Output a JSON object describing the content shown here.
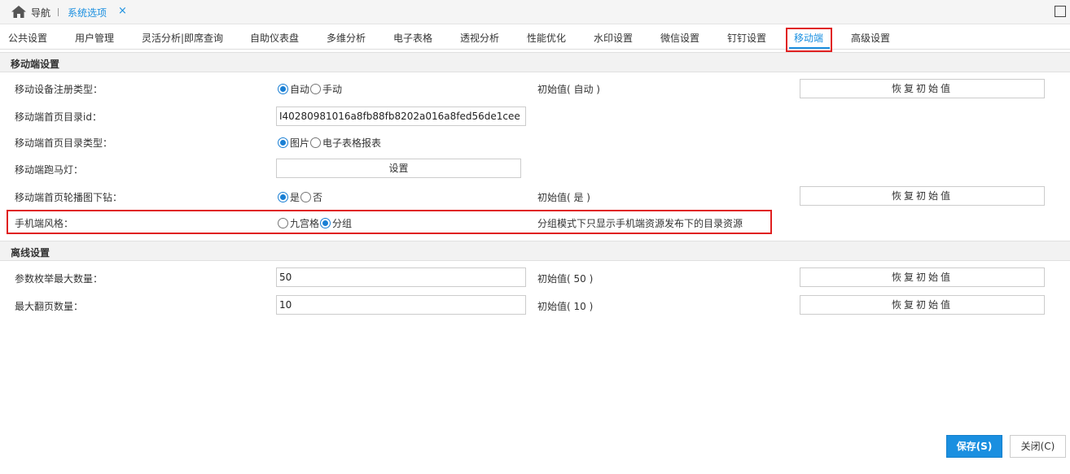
{
  "topbar": {
    "nav_label": "导航",
    "active_tab": "系统选项",
    "close_glyph": "×"
  },
  "tabs": [
    {
      "label": "公共设置"
    },
    {
      "label": "用户管理"
    },
    {
      "label": "灵活分析|即席查询"
    },
    {
      "label": "自助仪表盘"
    },
    {
      "label": "多维分析"
    },
    {
      "label": "电子表格"
    },
    {
      "label": "透视分析"
    },
    {
      "label": "性能优化"
    },
    {
      "label": "水印设置"
    },
    {
      "label": "微信设置"
    },
    {
      "label": "钉钉设置"
    },
    {
      "label": "移动端"
    },
    {
      "label": "高级设置"
    }
  ],
  "active_tab_index": 11,
  "mobile_section": {
    "title": "移动端设置",
    "device_register": {
      "label": "移动设备注册类型：",
      "options": [
        "自动",
        "手动"
      ],
      "selected": "自动",
      "initial": "初始值( 自动 )",
      "restore": "恢复初始值"
    },
    "home_dir_id": {
      "label": "移动端首页目录id：",
      "value": "I40280981016a8fb88fb8202a016a8fed56de1cee"
    },
    "home_dir_type": {
      "label": "移动端首页目录类型：",
      "options": [
        "图片",
        "电子表格报表"
      ],
      "selected": "图片"
    },
    "marquee": {
      "label": "移动端跑马灯：",
      "button": "设置"
    },
    "carousel_drill": {
      "label": "移动端首页轮播图下钻：",
      "options": [
        "是",
        "否"
      ],
      "selected": "是",
      "initial": "初始值( 是 )",
      "restore": "恢复初始值"
    },
    "phone_style": {
      "label": "手机端风格：",
      "options": [
        "九宫格",
        "分组"
      ],
      "selected": "分组",
      "hint": "分组模式下只显示手机端资源发布下的目录资源"
    }
  },
  "offline_section": {
    "title": "离线设置",
    "param_enum_max": {
      "label": "参数枚举最大数量：",
      "value": "50",
      "initial": "初始值( 50 )",
      "restore": "恢复初始值"
    },
    "max_pages": {
      "label": "最大翻页数量：",
      "value": "10",
      "initial": "初始值( 10 )",
      "restore": "恢复初始值"
    }
  },
  "footer": {
    "save": "保存(S)",
    "close": "关闭(C)"
  },
  "colors": {
    "accent": "#1a8fe0",
    "highlight_border": "#e02020"
  }
}
